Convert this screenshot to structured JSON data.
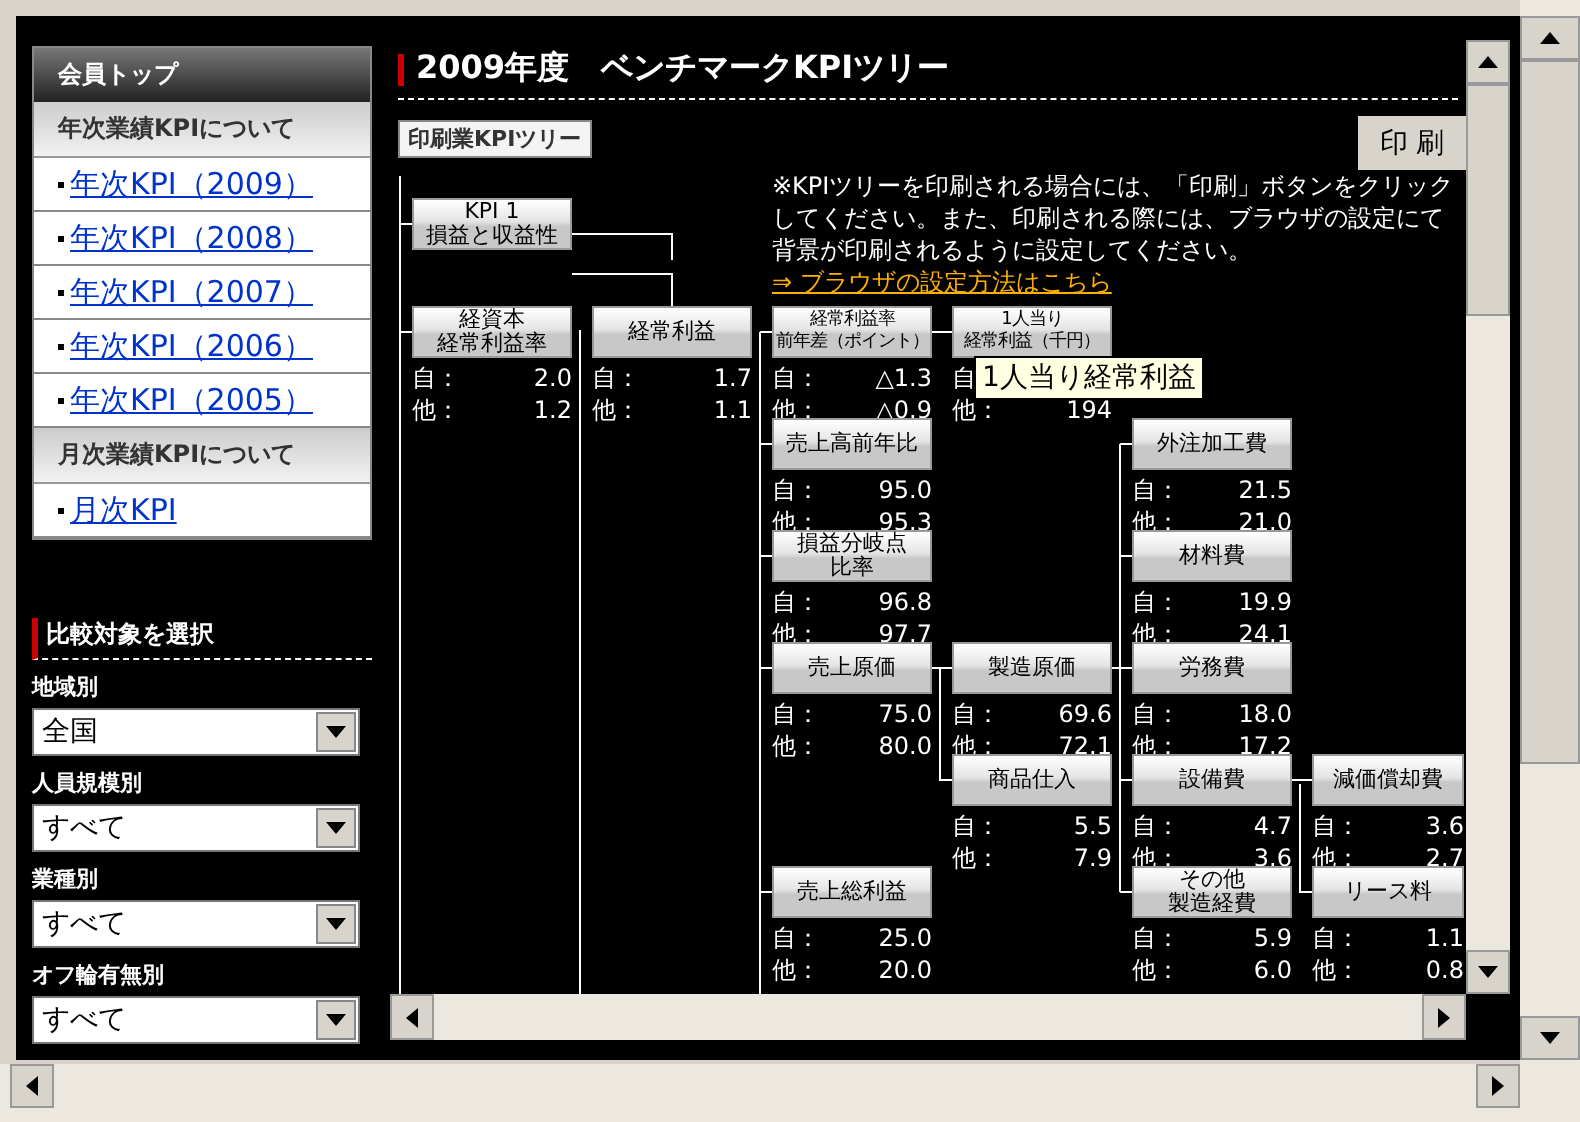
{
  "sidebar": {
    "header": "会員トップ",
    "sections": [
      {
        "title": "年次業績KPIについて",
        "links": [
          "年次KPI（2009）",
          "年次KPI（2008）",
          "年次KPI（2007）",
          "年次KPI（2006）",
          "年次KPI（2005）"
        ]
      },
      {
        "title": "月次業績KPIについて",
        "links": [
          "月次KPI"
        ]
      }
    ]
  },
  "compare": {
    "title": "比較対象を選択",
    "filters": [
      {
        "label": "地域別",
        "value": "全国"
      },
      {
        "label": "人員規模別",
        "value": "すべて"
      },
      {
        "label": "業種別",
        "value": "すべて"
      },
      {
        "label": "オフ輪有無別",
        "value": "すべて"
      }
    ]
  },
  "main": {
    "title": "2009年度　ベンチマークKPIツリー",
    "tree_label": "印刷業KPIツリー",
    "print_button": "印 刷",
    "note": "※KPIツリーを印刷される場合には、「印刷」ボタンをクリックしてください。また、印刷される際には、ブラウザの設定にて背景が印刷されるように設定してください。",
    "note_link": "⇒ ブラウザの設定方法はこちら",
    "tooltip": "1人当り経常利益",
    "tree": {
      "label": [
        "KPI 1",
        "損益と収益性"
      ],
      "children": [
        {
          "label": [
            "経資本",
            "経常利益率"
          ],
          "values": [
            {
              "label": "自：",
              "value": "2.0"
            },
            {
              "label": "他：",
              "value": "1.2"
            }
          ]
        },
        {
          "label": [
            "経常利益"
          ],
          "values": [
            {
              "label": "自：",
              "value": "1.7"
            },
            {
              "label": "他：",
              "value": "1.1"
            }
          ],
          "children": [
            {
              "label": [
                "経常利益率",
                "前年差（ポイント）"
              ],
              "values": [
                {
                  "label": "自：",
                  "value": "△1.3"
                },
                {
                  "label": "他：",
                  "value": "△0.9"
                }
              ],
              "children": [
                {
                  "label": [
                    "1人当り",
                    "経常利益（千円）"
                  ],
                  "values": [
                    {
                      "label": "自"
                    },
                    {
                      "label": "他：",
                      "value": "194"
                    }
                  ]
                }
              ]
            },
            {
              "label": [
                "売上高前年比"
              ],
              "values": [
                {
                  "label": "自：",
                  "value": "95.0"
                },
                {
                  "label": "他：",
                  "value": "95.3"
                }
              ]
            },
            {
              "label": [
                "損益分岐点",
                "比率"
              ],
              "values": [
                {
                  "label": "自：",
                  "value": "96.8"
                },
                {
                  "label": "他：",
                  "value": "97.7"
                }
              ]
            },
            {
              "label": [
                "売上原価"
              ],
              "values": [
                {
                  "label": "自：",
                  "value": "75.0"
                },
                {
                  "label": "他：",
                  "value": "80.0"
                }
              ],
              "children": [
                {
                  "label": [
                    "製造原価"
                  ],
                  "values": [
                    {
                      "label": "自：",
                      "value": "69.6"
                    },
                    {
                      "label": "他：",
                      "value": "72.1"
                    }
                  ],
                  "children": [
                    {
                      "label": [
                        "外注加工費"
                      ],
                      "values": [
                        {
                          "label": "自：",
                          "value": "21.5"
                        },
                        {
                          "label": "他：",
                          "value": "21.0"
                        }
                      ]
                    },
                    {
                      "label": [
                        "材料費"
                      ],
                      "values": [
                        {
                          "label": "自：",
                          "value": "19.9"
                        },
                        {
                          "label": "他：",
                          "value": "24.1"
                        }
                      ]
                    },
                    {
                      "label": [
                        "労務費"
                      ],
                      "values": [
                        {
                          "label": "自：",
                          "value": "18.0"
                        },
                        {
                          "label": "他：",
                          "value": "17.2"
                        }
                      ]
                    },
                    {
                      "label": [
                        "設備費"
                      ],
                      "values": [
                        {
                          "label": "自：",
                          "value": "4.7"
                        },
                        {
                          "label": "他：",
                          "value": "3.6"
                        }
                      ],
                      "children": [
                        {
                          "label": [
                            "減価償却費"
                          ],
                          "values": [
                            {
                              "label": "自：",
                              "value": "3.6"
                            },
                            {
                              "label": "他：",
                              "value": "2.7"
                            }
                          ]
                        },
                        {
                          "label": [
                            "リース料"
                          ],
                          "values": [
                            {
                              "label": "自：",
                              "value": "1.1"
                            },
                            {
                              "label": "他：",
                              "value": "0.8"
                            }
                          ]
                        }
                      ]
                    },
                    {
                      "label": [
                        "その他",
                        "製造経費"
                      ],
                      "values": [
                        {
                          "label": "自：",
                          "value": "5.9"
                        },
                        {
                          "label": "他：",
                          "value": "6.0"
                        }
                      ]
                    }
                  ]
                },
                {
                  "label": [
                    "商品仕入"
                  ],
                  "values": [
                    {
                      "label": "自：",
                      "value": "5.5"
                    },
                    {
                      "label": "他：",
                      "value": "7.9"
                    }
                  ]
                }
              ]
            },
            {
              "label": [
                "売上総利益"
              ],
              "values": [
                {
                  "label": "自：",
                  "value": "25.0"
                },
                {
                  "label": "他：",
                  "value": "20.0"
                }
              ]
            }
          ]
        }
      ]
    }
  }
}
